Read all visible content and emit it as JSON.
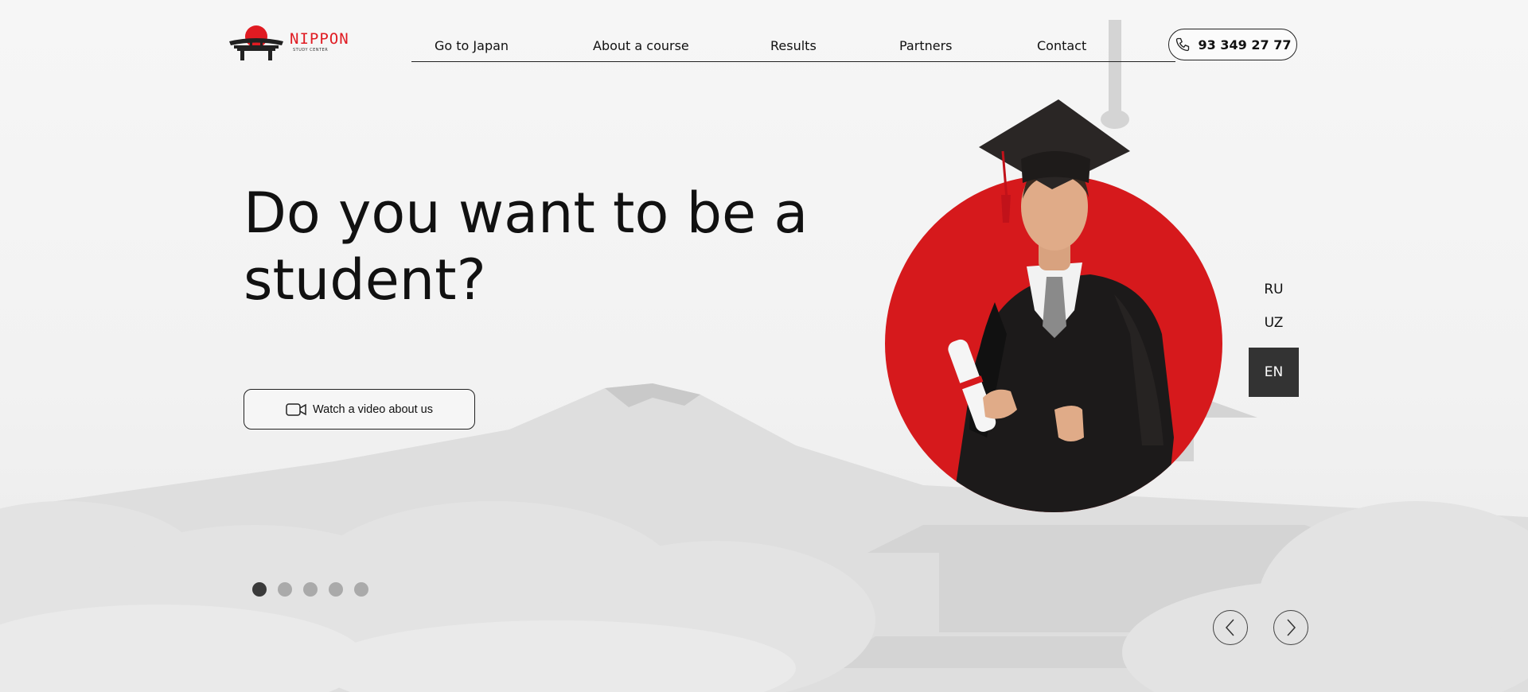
{
  "brand": {
    "name": "NIPPON",
    "subtitle": "STUDY CENTER",
    "accent": "#e01b22"
  },
  "nav": {
    "items": [
      {
        "label": "Go to Japan"
      },
      {
        "label": "About a course"
      },
      {
        "label": "Results"
      },
      {
        "label": "Partners"
      },
      {
        "label": "Contact"
      }
    ]
  },
  "contact": {
    "phone": "93 349 27 77",
    "icon": "phone-icon"
  },
  "hero": {
    "title": "Do you want to be a student?",
    "video_button": {
      "label": "Watch a video about us",
      "icon": "video-camera-icon"
    }
  },
  "slider": {
    "total_slides": 5,
    "active_slide": 1,
    "prev_icon": "chevron-left-icon",
    "next_icon": "chevron-right-icon"
  },
  "languages": {
    "options": [
      "RU",
      "UZ",
      "EN"
    ],
    "active": "EN"
  },
  "colors": {
    "accent_red": "#e01b22",
    "dark": "#333333",
    "text": "#111111"
  }
}
